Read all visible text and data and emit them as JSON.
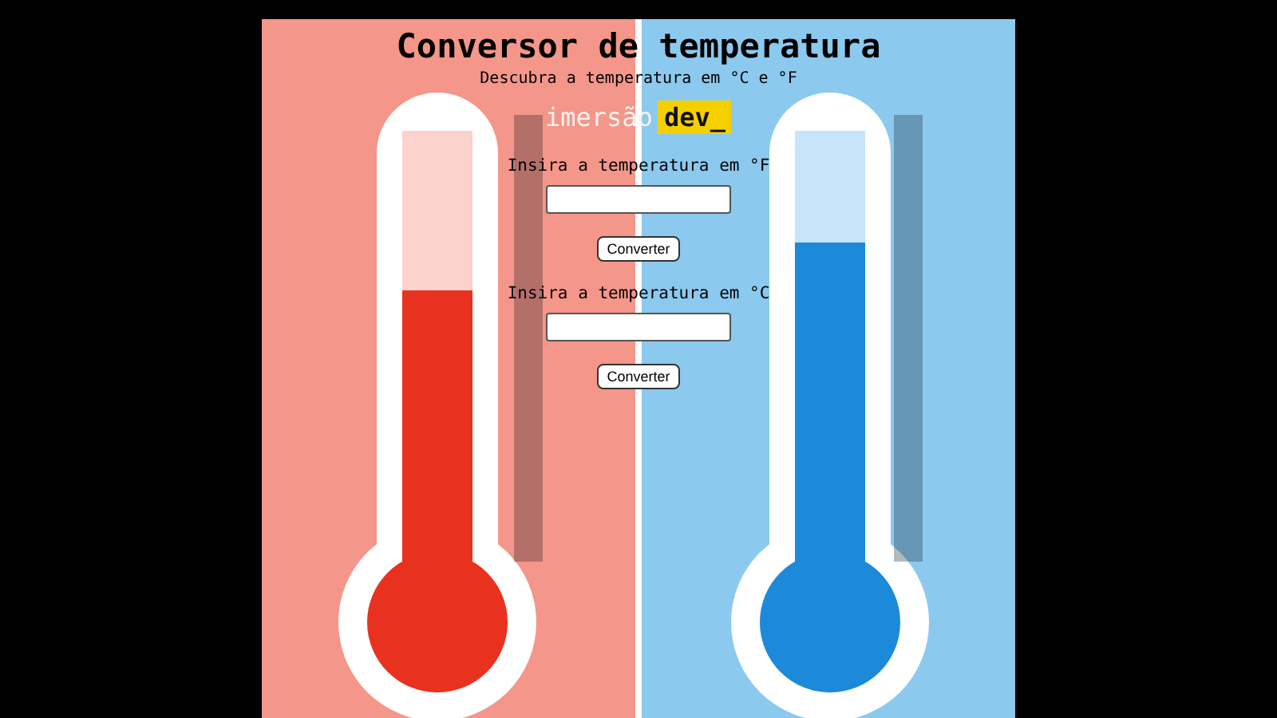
{
  "title": "Conversor de temperatura",
  "subtitle": "Descubra a temperatura em °C e °F",
  "logo": {
    "text": "imersão",
    "highlight": "dev_"
  },
  "converters": [
    {
      "label": "Insira a temperatura em °F",
      "button": "Converter"
    },
    {
      "label": "Insira a temperatura em °C",
      "button": "Converter"
    }
  ]
}
